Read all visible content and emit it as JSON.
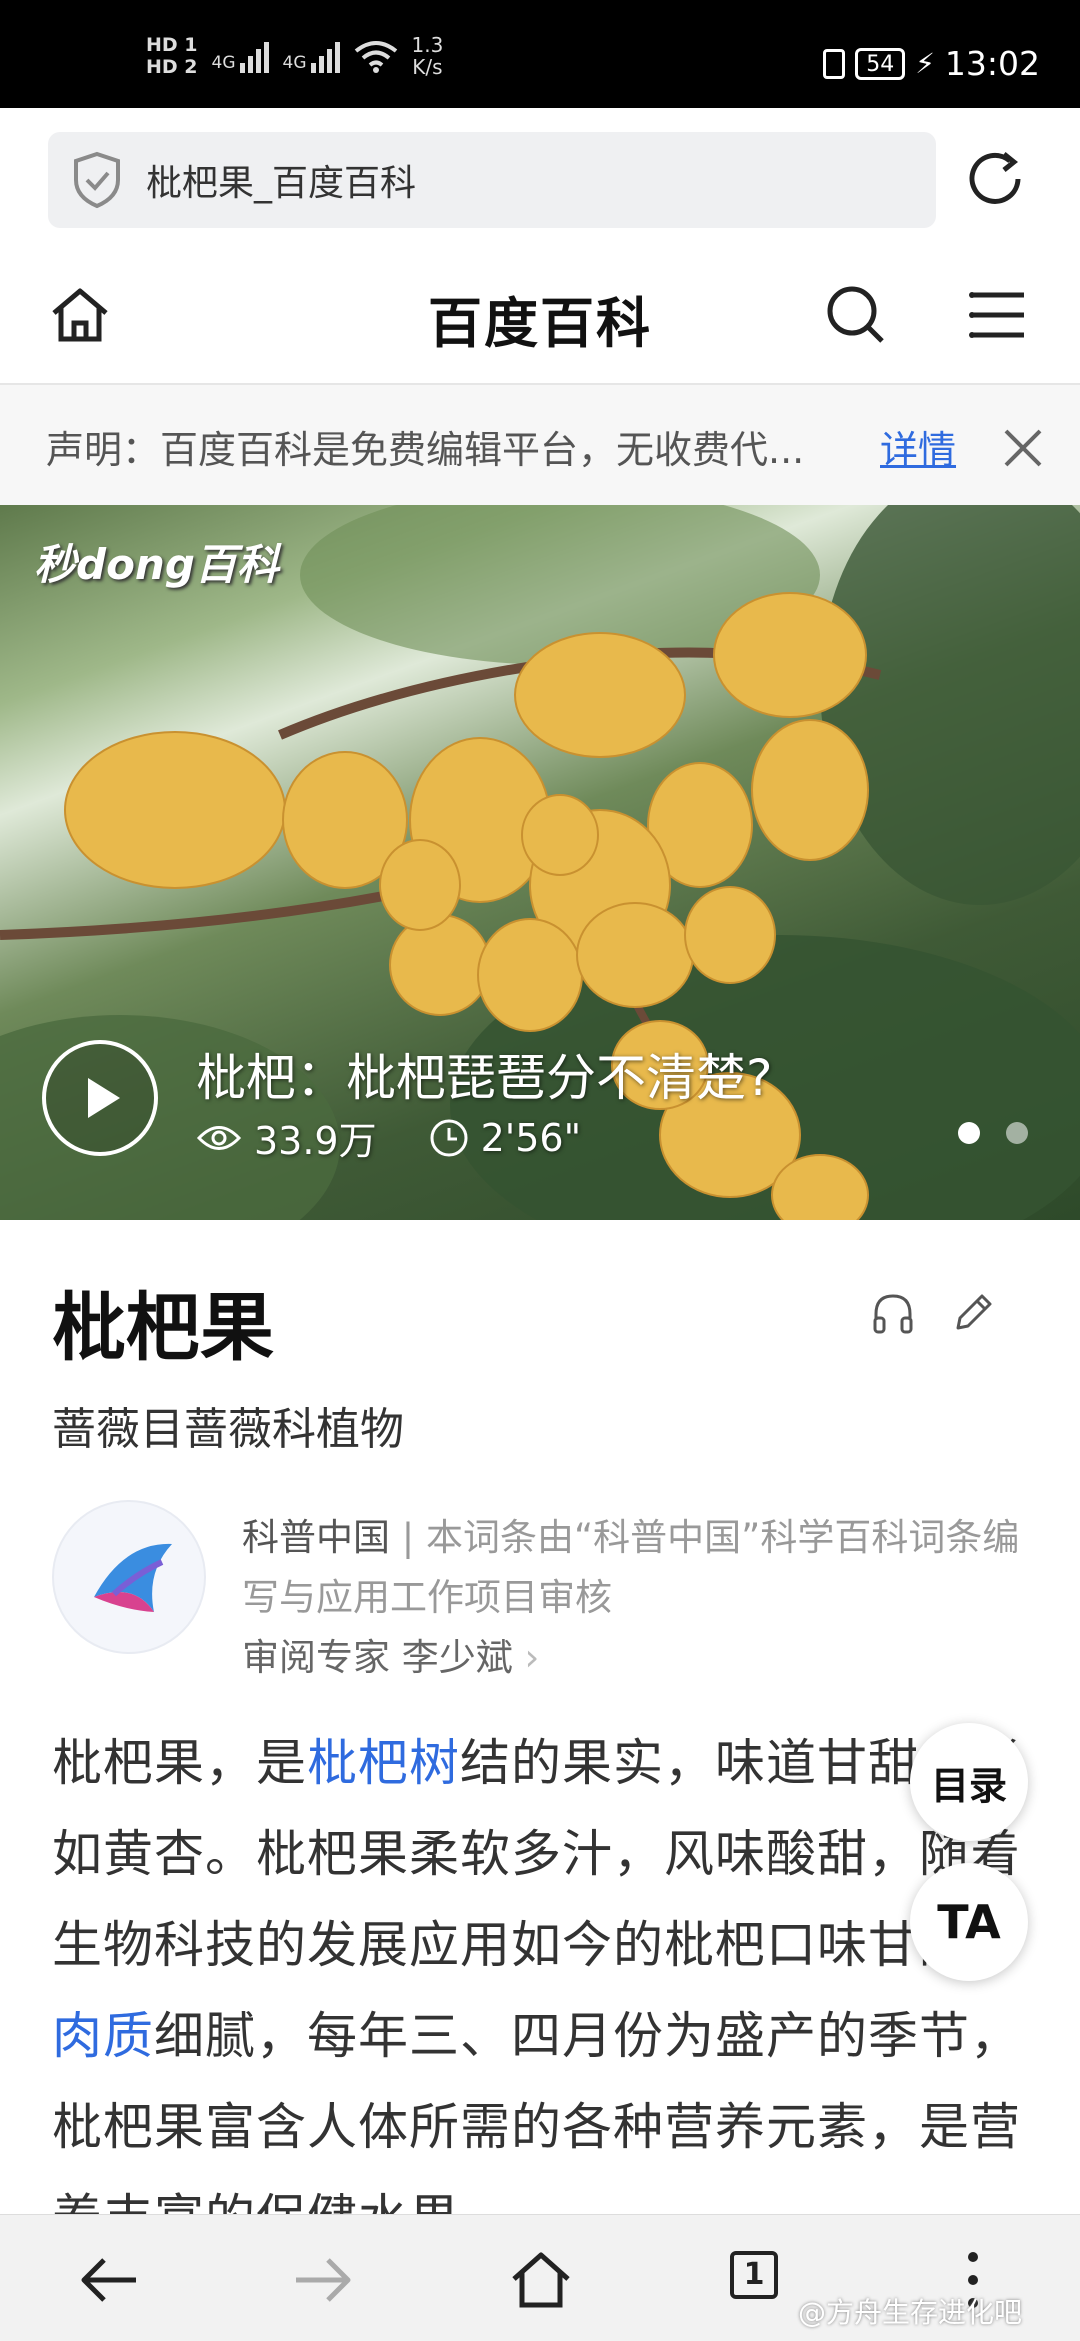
{
  "status_bar": {
    "hd1": "HD 1",
    "hd2": "HD 2",
    "net1": "4G",
    "net2": "4G",
    "speed_value": "1.3",
    "speed_unit": "K/s",
    "battery": "54",
    "time": "13:02"
  },
  "browser": {
    "url_text": "枇杷果_百度百科"
  },
  "site": {
    "title": "百度百科"
  },
  "notice": {
    "text": "声明：百度百科是免费编辑平台，无收费代...",
    "link_label": "详情"
  },
  "hero": {
    "watermark": "秒dong百科",
    "video_title": "枇杷：枇杷琵琶分不清楚?",
    "views": "33.9万",
    "duration": "2'56\""
  },
  "entry": {
    "title": "枇杷果",
    "subtitle": "蔷薇目蔷薇科植物",
    "reviewer_org": "科普中国",
    "reviewer_desc": "| 本词条由“科普中国”科学百科词条编写与应用工作项目审核",
    "reviewer_expert": "审阅专家 李少斌",
    "body": {
      "p1": "枇杷果，是",
      "link1": "枇杷树",
      "p2": "结的果实，味道甘甜，形如黄杏。枇杷果柔软多汁，风味酸甜，随着生物科技的发展应用如今的枇杷口味甘甜，",
      "link2": "肉质",
      "p3": "细腻，每年三、四月份为盛产的季节，枇杷果富含人体所需的各种营养元素，是营养丰富的保健水果。"
    }
  },
  "float_buttons": {
    "toc_label": "目录",
    "font_label": "TA"
  },
  "bottom_nav": {
    "tab_count": "1",
    "watermark": "@方舟生存进化吧"
  },
  "colors": {
    "link": "#2f6bdf",
    "status_bar_bg": "#000000"
  }
}
